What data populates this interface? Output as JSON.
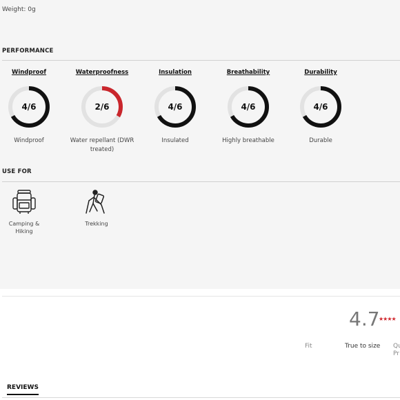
{
  "weight_text": "Weight: 0g",
  "performance": {
    "title": "PERFORMANCE",
    "items": [
      {
        "name": "Windproof",
        "score": "4/6",
        "level": 4,
        "max": 6,
        "color": "#111111",
        "desc": "Windproof"
      },
      {
        "name": "Waterproofness",
        "score": "2/6",
        "level": 2,
        "max": 6,
        "color": "#c9262c",
        "desc": "Water repellant (DWR treated)"
      },
      {
        "name": "Insulation",
        "score": "4/6",
        "level": 4,
        "max": 6,
        "color": "#111111",
        "desc": "Insulated"
      },
      {
        "name": "Breathability",
        "score": "4/6",
        "level": 4,
        "max": 6,
        "color": "#111111",
        "desc": "Highly breathable"
      },
      {
        "name": "Durability",
        "score": "4/6",
        "level": 4,
        "max": 6,
        "color": "#111111",
        "desc": "Durable"
      }
    ]
  },
  "use_for": {
    "title": "USE FOR",
    "items": [
      {
        "icon": "backpack-icon",
        "label": "Camping & Hiking"
      },
      {
        "icon": "trekker-icon",
        "label": "Trekking"
      }
    ]
  },
  "rating": {
    "value": "4.7",
    "stars": "★★★★",
    "fit_label": "Fit",
    "fit_value": "True to size",
    "quality_label": "Qu Pr"
  },
  "tabs": {
    "reviews": "REVIEWS"
  }
}
